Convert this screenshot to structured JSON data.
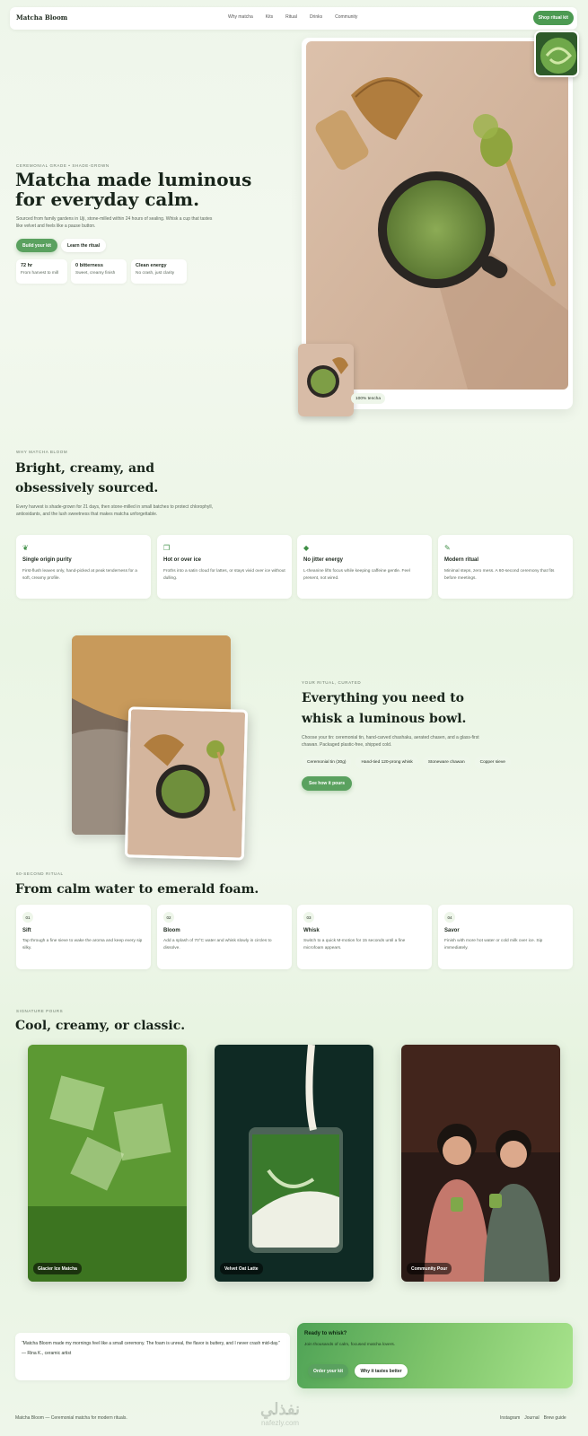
{
  "nav": {
    "brand": "Matcha Bloom",
    "links": [
      "Why matcha",
      "Kits",
      "Ritual",
      "Drinks",
      "Community"
    ],
    "cta": "Shop ritual kit"
  },
  "hero": {
    "eyebrow": "CEREMONIAL GRADE • SHADE-GROWN",
    "title": "Matcha made luminous for everyday calm.",
    "subtitle": "Sourced from family gardens in Uji, stone-milled within 24 hours of sealing. Whisk a cup that tastes like velvet and feels like a pause button.",
    "primary_btn": "Build your kit",
    "secondary_btn": "Learn the ritual",
    "stats": [
      {
        "value": "72 hr",
        "label": "From harvest to mill"
      },
      {
        "value": "0 bitterness",
        "label": "Sweet, creamy finish"
      },
      {
        "value": "Clean energy",
        "label": "No crash, just clarity"
      }
    ],
    "badge": "100% tencha"
  },
  "why": {
    "eyebrow": "WHY MATCHA BLOOM",
    "title": "Bright, creamy, and obsessively sourced.",
    "subtitle": "Every harvest is shade-grown for 21 days, then stone-milled in small batches to protect chlorophyll, antioxidants, and the lush sweetness that makes matcha unforgettable.",
    "features": [
      {
        "icon": "leaf-icon",
        "title": "Single origin purity",
        "desc": "First-flush leaves only, hand-picked at peak tenderness for a soft, creamy profile."
      },
      {
        "icon": "ice-icon",
        "title": "Hot or over ice",
        "desc": "Froths into a satin cloud for lattes, or stays vivid over ice without dulling."
      },
      {
        "icon": "drop-icon",
        "title": "No jitter energy",
        "desc": "L-theanine lifts focus while keeping caffeine gentle. Feel present, not wired."
      },
      {
        "icon": "whisk-icon",
        "title": "Modern ritual",
        "desc": "Minimal steps, zero mess. A 60-second ceremony that fits before meetings."
      }
    ]
  },
  "kit": {
    "eyebrow": "YOUR RITUAL, CURATED",
    "title": "Everything you need to whisk a luminous bowl.",
    "subtitle": "Choose your tin: ceremonial tin, hand-carved chashaku, aerated chasen, and a glass-first chawan. Packaged plastic-free, shipped cold.",
    "chips": [
      "Ceremonial tin (30g)",
      "Hand-tied 120-prong whisk",
      "Stoneware chawan",
      "Copper sieve"
    ],
    "cta": "See how it pours"
  },
  "ritual": {
    "eyebrow": "60-SECOND RITUAL",
    "title": "From calm water to emerald foam.",
    "steps": [
      {
        "num": "01",
        "title": "Sift",
        "desc": "Tap through a fine sieve to wake the aroma and keep every sip silky."
      },
      {
        "num": "02",
        "title": "Bloom",
        "desc": "Add a splash of 70°C water and whisk slowly in circles to dissolve."
      },
      {
        "num": "03",
        "title": "Whisk",
        "desc": "Switch to a quick M-motion for 15 seconds until a fine microfoam appears."
      },
      {
        "num": "04",
        "title": "Savor",
        "desc": "Finish with more hot water or cold milk over ice. Sip immediately."
      }
    ]
  },
  "pours": {
    "eyebrow": "SIGNATURE POURS",
    "title": "Cool, creamy, or classic.",
    "items": [
      {
        "label": "Glacier Ice Matcha"
      },
      {
        "label": "Velvet Oat Latte"
      },
      {
        "label": "Community Pour"
      }
    ]
  },
  "testimonial": {
    "quote": "“Matcha Bloom made my mornings feel like a small ceremony. The foam is unreal, the flavor is buttery, and I never crash mid-day.”",
    "author": "— Rina K., ceramic artist"
  },
  "cta": {
    "title": "Ready to whisk?",
    "subtitle": "Join thousands of calm, focused matcha lovers.",
    "btn1": "Order your kit",
    "btn2": "Why it tastes better"
  },
  "footer": {
    "left": "Matcha Bloom — Ceremonial matcha for modern rituals.",
    "links": [
      "Instagram",
      "Journal",
      "Brew guide"
    ]
  },
  "watermark": {
    "arabic": "نفذلي",
    "latin": "nafezly.com"
  }
}
